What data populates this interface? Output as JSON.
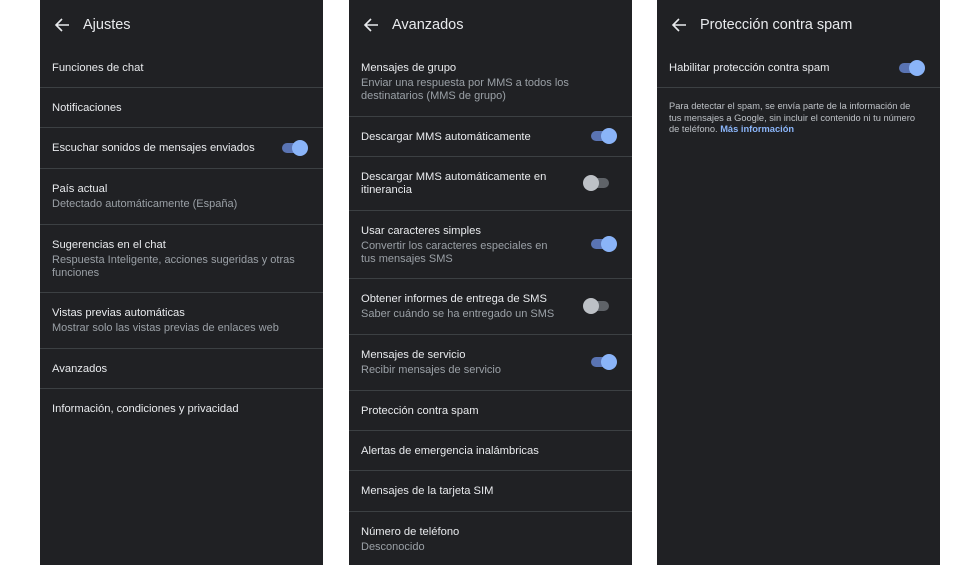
{
  "screen1": {
    "title": "Ajustes",
    "items": [
      {
        "title": "Funciones de chat"
      },
      {
        "title": "Notificaciones"
      },
      {
        "title": "Escuchar sonidos de mensajes enviados",
        "toggle": "on"
      },
      {
        "title": "País actual",
        "subtitle": "Detectado automáticamente (España)"
      },
      {
        "title": "Sugerencias en el chat",
        "subtitle": "Respuesta Inteligente, acciones sugeridas y otras funciones"
      },
      {
        "title": "Vistas previas automáticas",
        "subtitle": "Mostrar solo las vistas previas de enlaces web"
      },
      {
        "title": "Avanzados"
      },
      {
        "title": "Información, condiciones y privacidad"
      }
    ]
  },
  "screen2": {
    "title": "Avanzados",
    "items": [
      {
        "title": "Mensajes de grupo",
        "subtitle": "Enviar una respuesta por MMS a todos los destinatarios (MMS de grupo)"
      },
      {
        "title": "Descargar MMS automáticamente",
        "toggle": "on"
      },
      {
        "title": "Descargar MMS automáticamente en itinerancia",
        "toggle": "off"
      },
      {
        "title": "Usar caracteres simples",
        "subtitle": "Convertir los caracteres especiales en tus mensajes SMS",
        "toggle": "on"
      },
      {
        "title": "Obtener informes de entrega de SMS",
        "subtitle": "Saber cuándo se ha entregado un SMS",
        "toggle": "off"
      },
      {
        "title": "Mensajes de servicio",
        "subtitle": "Recibir mensajes de servicio",
        "toggle": "on"
      },
      {
        "title": "Protección contra spam"
      },
      {
        "title": "Alertas de emergencia inalámbricas"
      },
      {
        "title": "Mensajes de la tarjeta SIM"
      },
      {
        "title": "Número de teléfono",
        "subtitle": "Desconocido"
      }
    ]
  },
  "screen3": {
    "title": "Protección contra spam",
    "items": [
      {
        "title": "Habilitar protección contra spam",
        "toggle": "on"
      }
    ],
    "description": "Para detectar el spam, se envía parte de la información de tus mensajes a Google, sin incluir el contenido ni tu número de teléfono.",
    "link": "Más información"
  },
  "colors": {
    "background": "#202124",
    "divider": "#3c4043",
    "text_primary": "#e8eaed",
    "text_secondary": "#9aa0a6",
    "accent": "#8ab4f8"
  },
  "icons": {
    "back": "arrow-left-icon"
  }
}
